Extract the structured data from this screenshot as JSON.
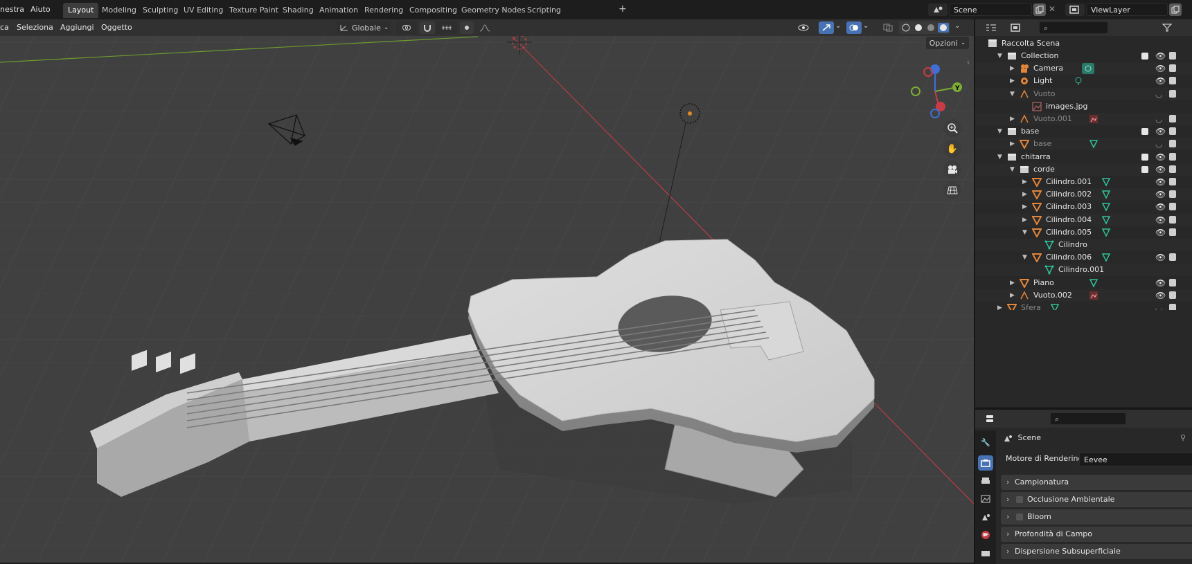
{
  "top_menu": [
    "nestra",
    "Aiuto"
  ],
  "workspace_tabs": [
    {
      "label": "Layout",
      "active": true
    },
    {
      "label": "Modeling",
      "active": false
    },
    {
      "label": "Sculpting",
      "active": false
    },
    {
      "label": "UV Editing",
      "active": false
    },
    {
      "label": "Texture Paint",
      "active": false
    },
    {
      "label": "Shading",
      "active": false
    },
    {
      "label": "Animation",
      "active": false
    },
    {
      "label": "Rendering",
      "active": false
    },
    {
      "label": "Compositing",
      "active": false
    },
    {
      "label": "Geometry Nodes",
      "active": false
    },
    {
      "label": "Scripting",
      "active": false
    }
  ],
  "add_tab": "+",
  "scene": {
    "value": "Scene"
  },
  "view_layer": {
    "value": "ViewLayer"
  },
  "viewport_header": {
    "menus": [
      "ca",
      "Seleziona",
      "Aggiungi",
      "Oggetto"
    ],
    "transform_orientation": "Globale",
    "options_label": "Opzioni"
  },
  "gizmo": {
    "y_label": "Y"
  },
  "outliner": {
    "root": "Raccolta Scena",
    "rows": [
      {
        "name": "Collection",
        "type": "collection",
        "depth": 1,
        "expanded": true,
        "checkbox": true,
        "dim": false
      },
      {
        "name": "Camera",
        "type": "camera",
        "depth": 2,
        "expanded": false,
        "dim": false
      },
      {
        "name": "Light",
        "type": "light",
        "depth": 2,
        "expanded": false,
        "dim": false
      },
      {
        "name": "Vuoto",
        "type": "empty",
        "depth": 2,
        "expanded": true,
        "dim": true
      },
      {
        "name": "images.jpg",
        "type": "image",
        "depth": 3,
        "expanded": null,
        "dim": false
      },
      {
        "name": "Vuoto.001",
        "type": "empty",
        "depth": 2,
        "expanded": false,
        "dim": true
      },
      {
        "name": "base",
        "type": "collection",
        "depth": 1,
        "expanded": true,
        "checkbox": true,
        "dim": false
      },
      {
        "name": "base",
        "type": "mesh",
        "depth": 2,
        "expanded": false,
        "dim": true
      },
      {
        "name": "chitarra",
        "type": "collection",
        "depth": 1,
        "expanded": true,
        "checkbox": true,
        "dim": false
      },
      {
        "name": "corde",
        "type": "collection",
        "depth": 2,
        "expanded": true,
        "checkbox": true,
        "dim": false
      },
      {
        "name": "Cilindro.001",
        "type": "mesh",
        "depth": 3,
        "expanded": false,
        "dim": false
      },
      {
        "name": "Cilindro.002",
        "type": "mesh",
        "depth": 3,
        "expanded": false,
        "dim": false
      },
      {
        "name": "Cilindro.003",
        "type": "mesh",
        "depth": 3,
        "expanded": false,
        "dim": false
      },
      {
        "name": "Cilindro.004",
        "type": "mesh",
        "depth": 3,
        "expanded": false,
        "dim": false
      },
      {
        "name": "Cilindro.005",
        "type": "mesh",
        "depth": 3,
        "expanded": true,
        "dim": false
      },
      {
        "name": "Cilindro",
        "type": "meshdata",
        "depth": 4,
        "expanded": null,
        "dim": false
      },
      {
        "name": "Cilindro.006",
        "type": "mesh",
        "depth": 3,
        "expanded": true,
        "dim": false
      },
      {
        "name": "Cilindro.001",
        "type": "meshdata",
        "depth": 4,
        "expanded": null,
        "dim": false
      },
      {
        "name": "Piano",
        "type": "mesh",
        "depth": 2,
        "expanded": false,
        "dim": false
      },
      {
        "name": "Vuoto.002",
        "type": "empty",
        "depth": 2,
        "expanded": false,
        "dim": false
      },
      {
        "name": "Sfera",
        "type": "mesh",
        "depth": 1,
        "expanded": false,
        "dim": true
      }
    ]
  },
  "properties": {
    "context": "Scene",
    "render_engine_label": "Motore di Rendering",
    "render_engine_value": "Eevee",
    "panels": [
      {
        "label": "Campionatura",
        "checkbox": false
      },
      {
        "label": "Occlusione Ambientale",
        "checkbox": true
      },
      {
        "label": "Bloom",
        "checkbox": true
      },
      {
        "label": "Profondità di Campo",
        "checkbox": false
      },
      {
        "label": "Dispersione Subsuperficiale",
        "checkbox": false
      }
    ]
  },
  "colors": {
    "accent": "#4772b3",
    "x_axis": "#c83c46",
    "y_axis": "#7cad33",
    "z_axis": "#3d6fd6",
    "mesh_icon": "#e3853a",
    "data_icon": "#2fc39b",
    "viewport_bg": "#404040"
  }
}
